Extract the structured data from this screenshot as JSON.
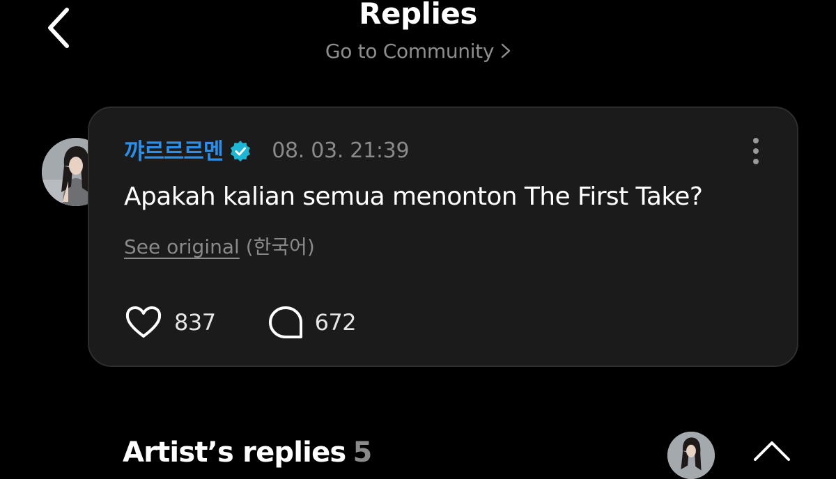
{
  "header": {
    "title": "Replies",
    "subtitle": "Go to Community"
  },
  "post": {
    "author": "꺄르르르멘",
    "timestamp": "08. 03. 21:39",
    "text": "Apakah kalian semua menonton The First Take?",
    "see_original": "See original",
    "original_language": "(한국어)",
    "likes": "837",
    "comments": "672"
  },
  "artist_replies": {
    "title": "Artist’s replies",
    "count": "5"
  },
  "colors": {
    "background": "#000000",
    "card": "#1b1b1b",
    "author_name": "#2b8ee8",
    "verified_badge": "#1fb6d6",
    "muted_text": "#8a8a8a"
  },
  "icons": {
    "back": "chevron-left-icon",
    "community_link": "chevron-right-icon",
    "verified": "verified-badge-icon",
    "more": "more-vertical-icon",
    "like": "heart-icon",
    "comment": "comment-bubble-icon",
    "collapse": "chevron-up-icon"
  }
}
